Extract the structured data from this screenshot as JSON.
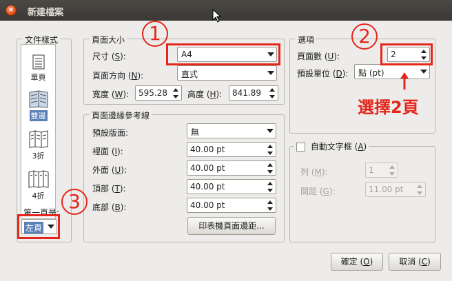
{
  "window": {
    "title": "新建檔案"
  },
  "doc_styles": {
    "title": "文件樣式",
    "items": [
      {
        "label": "單頁",
        "icon": "single-page-icon"
      },
      {
        "label": "雙邊",
        "icon": "double-sided-icon",
        "selected": true
      },
      {
        "label": "3折",
        "icon": "tri-fold-icon"
      },
      {
        "label": "4折",
        "icon": "quad-fold-icon"
      }
    ],
    "first_page_label": "第一頁是:",
    "first_page_value": "左頁"
  },
  "page_size": {
    "title": "頁面大小",
    "size_label": "尺寸 (",
    "size_key": "S",
    "size_tail": "):",
    "size_value": "A4",
    "orientation_label": "頁面方向 (",
    "orientation_key": "N",
    "orientation_tail": "):",
    "orientation_value": "直式",
    "width_label": "寬度 (",
    "width_key": "W",
    "width_tail": "):",
    "width_value": "595.28",
    "height_label": "高度 (",
    "height_key": "H",
    "height_tail": "):",
    "height_value": "841.89"
  },
  "margins": {
    "title": "頁面邊緣參考線",
    "preset_label": "預設版面:",
    "preset_value": "無",
    "inside_label": "裡面 (",
    "inside_key": "I",
    "inside_tail": "):",
    "inside_value": "40.00 pt",
    "outside_label": "外面 (",
    "outside_key": "U",
    "outside_tail": "):",
    "outside_value": "40.00 pt",
    "top_label": "頂部 (",
    "top_key": "T",
    "top_tail": "):",
    "top_value": "40.00 pt",
    "bottom_label": "底部 (",
    "bottom_key": "B",
    "bottom_tail": "):",
    "bottom_value": "40.00 pt",
    "printer_button": "印表機頁面邊距..."
  },
  "options": {
    "title": "選項",
    "pages_label": "頁面數 (",
    "pages_key": "U",
    "pages_tail": "):",
    "pages_value": "2",
    "unit_label": "預設單位 (",
    "unit_key": "D",
    "unit_tail": "):",
    "unit_value": "點 (pt)"
  },
  "auto_text": {
    "title_prefix": "自動文字框 (",
    "title_key": "A",
    "title_tail": ")",
    "columns_label": "列 (",
    "columns_key": "M",
    "columns_tail": "):",
    "columns_value": "1",
    "gap_label": "間距 (",
    "gap_key": "G",
    "gap_tail": "):",
    "gap_value": "11.00 pt"
  },
  "buttons": {
    "ok": "確定 (",
    "ok_key": "O",
    "ok_tail": ")",
    "cancel": "取消 (",
    "cancel_key": "C",
    "cancel_tail": ")"
  },
  "annotations": {
    "num1": "1",
    "num2": "2",
    "num3": "3",
    "note2": "選擇2頁",
    "color": "#e4261b"
  }
}
